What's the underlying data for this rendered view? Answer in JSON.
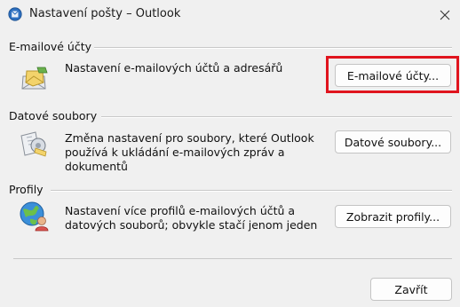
{
  "window": {
    "title": "Nastavení pošty – Outlook",
    "app_icon": "outlook-icon",
    "close_icon": "close-icon"
  },
  "sections": [
    {
      "heading": "E-mailové účty",
      "icon": "email-accounts-icon",
      "description": "Nastavení e-mailových účtů a adresářů",
      "button": "E-mailové účty...",
      "button_highlighted": true
    },
    {
      "heading": "Datové soubory",
      "icon": "data-files-icon",
      "description": "Změna nastavení pro soubory, které Outlook používá k ukládání e-mailových zpráv a dokumentů",
      "button": "Datové soubory..."
    },
    {
      "heading": "Profily",
      "icon": "profiles-icon",
      "description": "Nastavení více profilů e-mailových účtů a datových souborů; obvykle stačí jenom jeden",
      "button": "Zobrazit profily..."
    }
  ],
  "footer": {
    "close_button": "Zavřít"
  },
  "colors": {
    "highlight": "#e0141e",
    "background": "#f0f0f0"
  }
}
